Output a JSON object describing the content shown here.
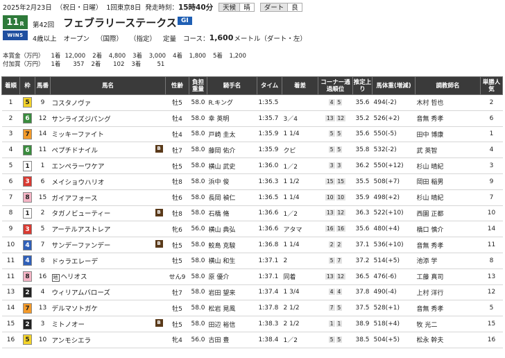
{
  "header": {
    "date": "2025年2月23日",
    "day": "（祝日・日曜）",
    "meeting": "1回東京8日",
    "post_label": "発走時刻：",
    "post_time": "15時40分",
    "weather_label": "天候",
    "weather": "晴",
    "track_label": "ダート",
    "track": "良"
  },
  "race": {
    "number": "11",
    "number_suffix": "R",
    "logo": "WIN5",
    "ordinal": "第42回",
    "name": "フェブラリーステークス",
    "grade": "GI",
    "age": "4歳以上",
    "class": "オープン",
    "cond1": "（国際）",
    "cond2": "（指定）",
    "weight_rule": "定量",
    "course_label": "コース：",
    "distance": "1,600",
    "course_unit": "メートル（ダート・左）"
  },
  "prize": {
    "label": "本賞金（万円）",
    "items": [
      {
        "rank": "1着",
        "value": "12,000"
      },
      {
        "rank": "2着",
        "value": "4,800"
      },
      {
        "rank": "3着",
        "value": "3,000"
      },
      {
        "rank": "4着",
        "value": "1,800"
      },
      {
        "rank": "5着",
        "value": "1,200"
      }
    ]
  },
  "added": {
    "label": "付加賞（万円）",
    "items": [
      {
        "rank": "1着",
        "value": "357"
      },
      {
        "rank": "2着",
        "value": "102"
      },
      {
        "rank": "3着",
        "value": "51"
      }
    ]
  },
  "table": {
    "headers": [
      "着順",
      "枠",
      "馬番",
      "馬名",
      "性齢",
      "負担重量",
      "騎手名",
      "タイム",
      "着差",
      "コーナー通過順位",
      "推定上り",
      "馬体重(増減)",
      "調教師名",
      "単勝人気"
    ],
    "rows": [
      {
        "rank": "1",
        "waku": "5",
        "num": "9",
        "horse": "コスタノヴァ",
        "mark": "",
        "blinker": false,
        "sex": "牡5",
        "wt": "58.0",
        "jockey": "R.キング",
        "time": "1:35.5",
        "margin": "",
        "corners": [
          "4",
          "5"
        ],
        "agari": "35.6",
        "bw": "494(-2)",
        "trainer": "木村 哲也",
        "pop": "2"
      },
      {
        "rank": "2",
        "waku": "6",
        "num": "12",
        "horse": "サンライズジパング",
        "mark": "",
        "blinker": false,
        "sex": "牡4",
        "wt": "58.0",
        "jockey": "幸 英明",
        "time": "1:35.7",
        "margin": "3／4",
        "corners": [
          "13",
          "12"
        ],
        "agari": "35.2",
        "bw": "526(+2)",
        "trainer": "音無 秀孝",
        "pop": "6"
      },
      {
        "rank": "3",
        "waku": "7",
        "num": "14",
        "horse": "ミッキーファイト",
        "mark": "",
        "blinker": false,
        "sex": "牡4",
        "wt": "58.0",
        "jockey": "戸崎 圭太",
        "time": "1:35.9",
        "margin": "1 1/4",
        "corners": [
          "5",
          "5"
        ],
        "agari": "35.6",
        "bw": "550(-5)",
        "trainer": "田中 博康",
        "pop": "1"
      },
      {
        "rank": "4",
        "waku": "6",
        "num": "11",
        "horse": "ペプチドナイル",
        "mark": "",
        "blinker": true,
        "sex": "牡7",
        "wt": "58.0",
        "jockey": "藤岡 佑介",
        "time": "1:35.9",
        "margin": "クビ",
        "corners": [
          "5",
          "5"
        ],
        "agari": "35.8",
        "bw": "532(-2)",
        "trainer": "武 英智",
        "pop": "4"
      },
      {
        "rank": "5",
        "waku": "1",
        "num": "1",
        "horse": "エンペラーワケア",
        "mark": "",
        "blinker": false,
        "sex": "牡5",
        "wt": "58.0",
        "jockey": "横山 武史",
        "time": "1:36.0",
        "margin": "1／2",
        "corners": [
          "3",
          "3"
        ],
        "agari": "36.2",
        "bw": "550(+12)",
        "trainer": "杉山 晴紀",
        "pop": "3"
      },
      {
        "rank": "6",
        "waku": "3",
        "num": "6",
        "horse": "メイショウハリオ",
        "mark": "",
        "blinker": false,
        "sex": "牡8",
        "wt": "58.0",
        "jockey": "浜中 俊",
        "time": "1:36.3",
        "margin": "1 1/2",
        "corners": [
          "15",
          "15"
        ],
        "agari": "35.5",
        "bw": "508(+7)",
        "trainer": "岡田 稲男",
        "pop": "9"
      },
      {
        "rank": "7",
        "waku": "8",
        "num": "15",
        "horse": "ガイアフォース",
        "mark": "",
        "blinker": false,
        "sex": "牡6",
        "wt": "58.0",
        "jockey": "長岡 禎仁",
        "time": "1:36.5",
        "margin": "1 1/4",
        "corners": [
          "10",
          "10"
        ],
        "agari": "35.9",
        "bw": "498(+2)",
        "trainer": "杉山 晴紀",
        "pop": "7"
      },
      {
        "rank": "8",
        "waku": "1",
        "num": "2",
        "horse": "タガノビューティー",
        "mark": "",
        "blinker": true,
        "sex": "牡8",
        "wt": "58.0",
        "jockey": "石橋 脩",
        "time": "1:36.6",
        "margin": "1／2",
        "corners": [
          "13",
          "12"
        ],
        "agari": "36.3",
        "bw": "522(+10)",
        "trainer": "西園 正都",
        "pop": "10"
      },
      {
        "rank": "9",
        "waku": "3",
        "num": "5",
        "horse": "アーテルアストレア",
        "mark": "",
        "blinker": false,
        "sex": "牝6",
        "wt": "56.0",
        "jockey": "横山 典弘",
        "time": "1:36.6",
        "margin": "アタマ",
        "corners": [
          "16",
          "16"
        ],
        "agari": "35.6",
        "bw": "480(+4)",
        "trainer": "橋口 慎介",
        "pop": "14"
      },
      {
        "rank": "10",
        "waku": "4",
        "num": "7",
        "horse": "サンデーファンデー",
        "mark": "",
        "blinker": true,
        "sex": "牡5",
        "wt": "58.0",
        "jockey": "鮫島 克駿",
        "time": "1:36.8",
        "margin": "1 1/4",
        "corners": [
          "2",
          "2"
        ],
        "agari": "37.1",
        "bw": "536(+10)",
        "trainer": "音無 秀孝",
        "pop": "11"
      },
      {
        "rank": "11",
        "waku": "4",
        "num": "8",
        "horse": "ドゥラエレーデ",
        "mark": "",
        "blinker": false,
        "sex": "牡5",
        "wt": "58.0",
        "jockey": "横山 和生",
        "time": "1:37.1",
        "margin": "2",
        "corners": [
          "5",
          "7"
        ],
        "agari": "37.2",
        "bw": "514(+5)",
        "trainer": "池添 学",
        "pop": "8"
      },
      {
        "rank": "11",
        "waku": "8",
        "num": "16",
        "horse": "ヘリオス",
        "mark": "地",
        "blinker": false,
        "sex": "せん9",
        "wt": "58.0",
        "jockey": "原 優介",
        "time": "1:37.1",
        "margin": "同着",
        "corners": [
          "13",
          "12"
        ],
        "agari": "36.5",
        "bw": "476(-6)",
        "trainer": "工藤 真司",
        "pop": "13"
      },
      {
        "rank": "13",
        "waku": "2",
        "num": "4",
        "horse": "ウィリアムバローズ",
        "mark": "",
        "blinker": false,
        "sex": "牡7",
        "wt": "58.0",
        "jockey": "岩田 望来",
        "time": "1:37.4",
        "margin": "1 3/4",
        "corners": [
          "4",
          "4"
        ],
        "agari": "37.8",
        "bw": "490(-4)",
        "trainer": "上村 洋行",
        "pop": "12"
      },
      {
        "rank": "14",
        "waku": "7",
        "num": "13",
        "horse": "デルマソトガケ",
        "mark": "",
        "blinker": false,
        "sex": "牡5",
        "wt": "58.0",
        "jockey": "松岩 晃風",
        "time": "1:37.8",
        "margin": "2 1/2",
        "corners": [
          "7",
          "5"
        ],
        "agari": "37.5",
        "bw": "528(+1)",
        "trainer": "音無 秀孝",
        "pop": "5"
      },
      {
        "rank": "15",
        "waku": "2",
        "num": "3",
        "horse": "ミトノオー",
        "mark": "",
        "blinker": true,
        "sex": "牡5",
        "wt": "58.0",
        "jockey": "田辺 裕信",
        "time": "1:38.3",
        "margin": "2 1/2",
        "corners": [
          "1",
          "1"
        ],
        "agari": "38.9",
        "bw": "518(+4)",
        "trainer": "牧 光二",
        "pop": "15"
      },
      {
        "rank": "16",
        "waku": "5",
        "num": "10",
        "horse": "アンモシエラ",
        "mark": "",
        "blinker": false,
        "sex": "牝4",
        "wt": "56.0",
        "jockey": "古田 豊",
        "time": "1:38.4",
        "margin": "1／2",
        "corners": [
          "5",
          "5"
        ],
        "agari": "38.5",
        "bw": "504(+5)",
        "trainer": "松永 幹夫",
        "pop": "16"
      }
    ]
  },
  "colors": {
    "waku": {
      "1": "#ffffff",
      "2": "#222222",
      "3": "#d93a32",
      "4": "#2f5fb8",
      "5": "#f3d32a",
      "6": "#3a8c3e",
      "7": "#f39a2a",
      "8": "#f5b5c6"
    },
    "waku_text": {
      "1": "#222222",
      "2": "#ffffff",
      "3": "#ffffff",
      "4": "#ffffff",
      "5": "#222222",
      "6": "#ffffff",
      "7": "#222222",
      "8": "#222222"
    },
    "race_badge": "#2e7a3a",
    "grade": "#1f5fb4",
    "header_bg": "#3a3a3a"
  },
  "blinker_label": "B"
}
